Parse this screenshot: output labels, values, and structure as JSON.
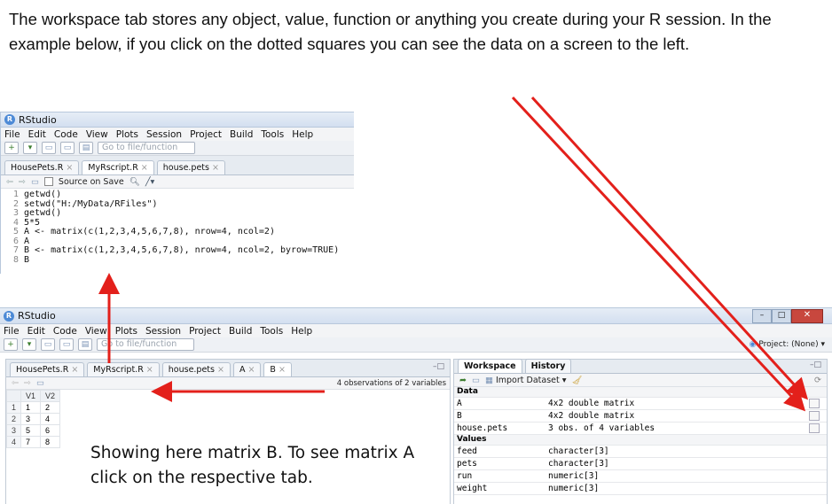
{
  "intro_text": "The workspace tab stores any object, value, function or anything you create during your R session. In the example below, if you click on the dotted squares you can see the data on a screen to the left.",
  "caption_text": "Showing here matrix B. To see matrix A click on the respective tab.",
  "colors": {
    "arrow": "#e3201b",
    "accent": "#4d8ad6"
  },
  "top_window": {
    "title": "RStudio",
    "menu": [
      "File",
      "Edit",
      "Code",
      "View",
      "Plots",
      "Session",
      "Project",
      "Build",
      "Tools",
      "Help"
    ],
    "goto_placeholder": "Go to file/function",
    "tabs": [
      {
        "label": "HousePets.R",
        "active": false
      },
      {
        "label": "MyRscript.R",
        "active": true
      },
      {
        "label": "house.pets",
        "active": false
      }
    ],
    "source_on_save": "Source on Save",
    "code_lines": [
      {
        "n": "1",
        "t": "getwd()"
      },
      {
        "n": "2",
        "t": "setwd(\"H:/MyData/RFiles\")"
      },
      {
        "n": "3",
        "t": "getwd()"
      },
      {
        "n": "4",
        "t": "5*5"
      },
      {
        "n": "5",
        "t": "A <- matrix(c(1,2,3,4,5,6,7,8), nrow=4, ncol=2)"
      },
      {
        "n": "6",
        "t": "A"
      },
      {
        "n": "7",
        "t": "B <- matrix(c(1,2,3,4,5,6,7,8), nrow=4, ncol=2, byrow=TRUE)"
      },
      {
        "n": "8",
        "t": "B"
      }
    ]
  },
  "bottom_window": {
    "title": "RStudio",
    "menu": [
      "File",
      "Edit",
      "Code",
      "View",
      "Plots",
      "Session",
      "Project",
      "Build",
      "Tools",
      "Help"
    ],
    "goto_placeholder": "Go to file/function",
    "project_label": "Project: (None)",
    "tabs": [
      {
        "label": "HousePets.R"
      },
      {
        "label": "MyRscript.R"
      },
      {
        "label": "house.pets"
      },
      {
        "label": "A"
      },
      {
        "label": "B"
      }
    ],
    "obs_text": "4 observations of 2 variables",
    "grid_headers": [
      "",
      "V1",
      "V2"
    ],
    "grid_rows": [
      [
        "1",
        "1",
        "2"
      ],
      [
        "2",
        "3",
        "4"
      ],
      [
        "3",
        "5",
        "6"
      ],
      [
        "4",
        "7",
        "8"
      ]
    ],
    "ws_tabs": [
      "Workspace",
      "History"
    ],
    "import_label": "Import Dataset",
    "data_header": "Data",
    "data_rows": [
      {
        "name": "A",
        "value": "4x2 double matrix"
      },
      {
        "name": "B",
        "value": "4x2 double matrix"
      },
      {
        "name": "house.pets",
        "value": "3 obs. of 4 variables"
      }
    ],
    "values_header": "Values",
    "value_rows": [
      {
        "name": "feed",
        "value": "character[3]"
      },
      {
        "name": "pets",
        "value": "character[3]"
      },
      {
        "name": "run",
        "value": "numeric[3]"
      },
      {
        "name": "weight",
        "value": "numeric[3]"
      }
    ]
  }
}
